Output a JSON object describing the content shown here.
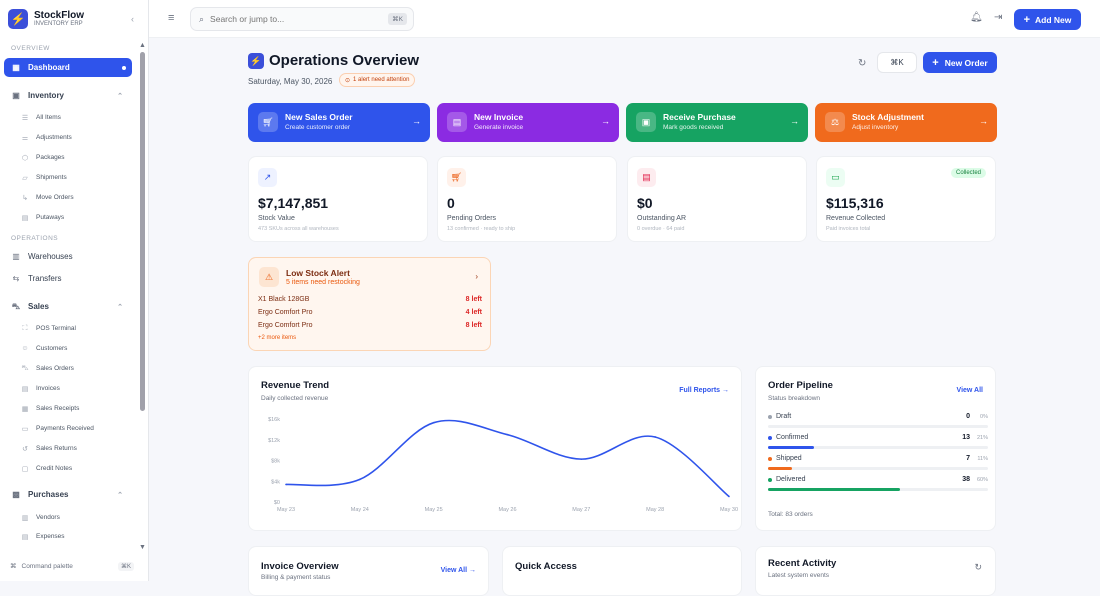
{
  "app": {
    "name": "StockFlow",
    "subtitle": "INVENTORY ERP"
  },
  "sidebar": {
    "section_overview": "OVERVIEW",
    "dashboard": "Dashboard",
    "inventory": {
      "label": "Inventory",
      "items": [
        "All Items",
        "Adjustments",
        "Packages",
        "Shipments",
        "Move Orders",
        "Putaways"
      ]
    },
    "section_operations": "OPERATIONS",
    "warehouses": "Warehouses",
    "transfers": "Transfers",
    "sales": {
      "label": "Sales",
      "items": [
        "POS Terminal",
        "Customers",
        "Sales Orders",
        "Invoices",
        "Sales Receipts",
        "Payments Received",
        "Sales Returns",
        "Credit Notes"
      ]
    },
    "purchases": {
      "label": "Purchases",
      "items": [
        "Vendors",
        "Expenses"
      ]
    },
    "command_palette": "Command palette",
    "command_shortcut": "⌘K"
  },
  "topbar": {
    "search_placeholder": "Search or jump to...",
    "search_shortcut": "⌘K",
    "add_new": "Add New"
  },
  "header": {
    "title": "Operations Overview",
    "date": "Saturday, May 30, 2026",
    "alert_chip": "1 alert need attention",
    "cmdk": "⌘K",
    "new_order": "New Order"
  },
  "quick_actions": [
    {
      "title": "New Sales Order",
      "sub": "Create customer order",
      "color": "#2f54eb",
      "icon": "cart-icon",
      "glyph": "🛒"
    },
    {
      "title": "New Invoice",
      "sub": "Generate invoice",
      "color": "#8b2be2",
      "icon": "document-icon",
      "glyph": "▤"
    },
    {
      "title": "Receive Purchase",
      "sub": "Mark goods received",
      "color": "#16a362",
      "icon": "box-icon",
      "glyph": "▣"
    },
    {
      "title": "Stock Adjustment",
      "sub": "Adjust inventory",
      "color": "#f06a1d",
      "icon": "adjust-icon",
      "glyph": "⚖"
    }
  ],
  "kpis": [
    {
      "value": "$7,147,851",
      "label": "Stock Value",
      "sub": "473 SKUs across all warehouses",
      "icon": "trend-icon",
      "glyph": "↗",
      "bg": "#eef2ff",
      "fg": "#2f54eb"
    },
    {
      "value": "0",
      "label": "Pending Orders",
      "sub": "13 confirmed · ready to ship",
      "icon": "cart-icon",
      "glyph": "🛒",
      "bg": "#fff1ea",
      "fg": "#ea580c"
    },
    {
      "value": "$0",
      "label": "Outstanding AR",
      "sub": "0 overdue · 64 paid",
      "icon": "document-icon",
      "glyph": "▤",
      "bg": "#fdecef",
      "fg": "#e11d48"
    },
    {
      "value": "$115,316",
      "label": "Revenue Collected",
      "sub": "Paid invoices total",
      "icon": "cash-icon",
      "glyph": "▭",
      "bg": "#ecfdf3",
      "fg": "#16a34a",
      "badge": "Collected"
    }
  ],
  "low_stock": {
    "title": "Low Stock Alert",
    "subtitle": "5 items need restocking",
    "items": [
      {
        "name": "X1 Black 128GB",
        "qty": "8 left"
      },
      {
        "name": "Ergo Comfort Pro",
        "qty": "4 left"
      },
      {
        "name": "Ergo Comfort Pro",
        "qty": "8 left"
      }
    ],
    "more": "+2 more items"
  },
  "revenue": {
    "title": "Revenue Trend",
    "subtitle": "Daily collected revenue",
    "link": "Full Reports →"
  },
  "pipeline": {
    "title": "Order Pipeline",
    "subtitle": "Status breakdown",
    "link": "View All",
    "rows": [
      {
        "label": "Draft",
        "value": "0",
        "pct": "0%",
        "frac": 0,
        "color": "#9ca3af"
      },
      {
        "label": "Confirmed",
        "value": "13",
        "pct": "21%",
        "frac": 0.21,
        "color": "#2f54eb"
      },
      {
        "label": "Shipped",
        "value": "7",
        "pct": "11%",
        "frac": 0.11,
        "color": "#f06a1d"
      },
      {
        "label": "Delivered",
        "value": "38",
        "pct": "60%",
        "frac": 0.6,
        "color": "#16a362"
      }
    ],
    "total": "Total: 83 orders"
  },
  "invoice_overview": {
    "title": "Invoice Overview",
    "subtitle": "Billing & payment status",
    "link": "View All →"
  },
  "quick_access": {
    "title": "Quick Access"
  },
  "recent_activity": {
    "title": "Recent Activity",
    "subtitle": "Latest system events"
  },
  "chart_data": {
    "type": "line",
    "x": [
      "May 23",
      "May 24",
      "May 25",
      "May 26",
      "May 27",
      "May 28",
      "May 30"
    ],
    "values": [
      3800,
      4900,
      17200,
      14600,
      9300,
      14100,
      1200
    ],
    "yticks": [
      "$16k",
      "$12k",
      "$8k",
      "$4k",
      "$0"
    ],
    "ylim": [
      0,
      18000
    ],
    "color": "#2f54eb"
  }
}
